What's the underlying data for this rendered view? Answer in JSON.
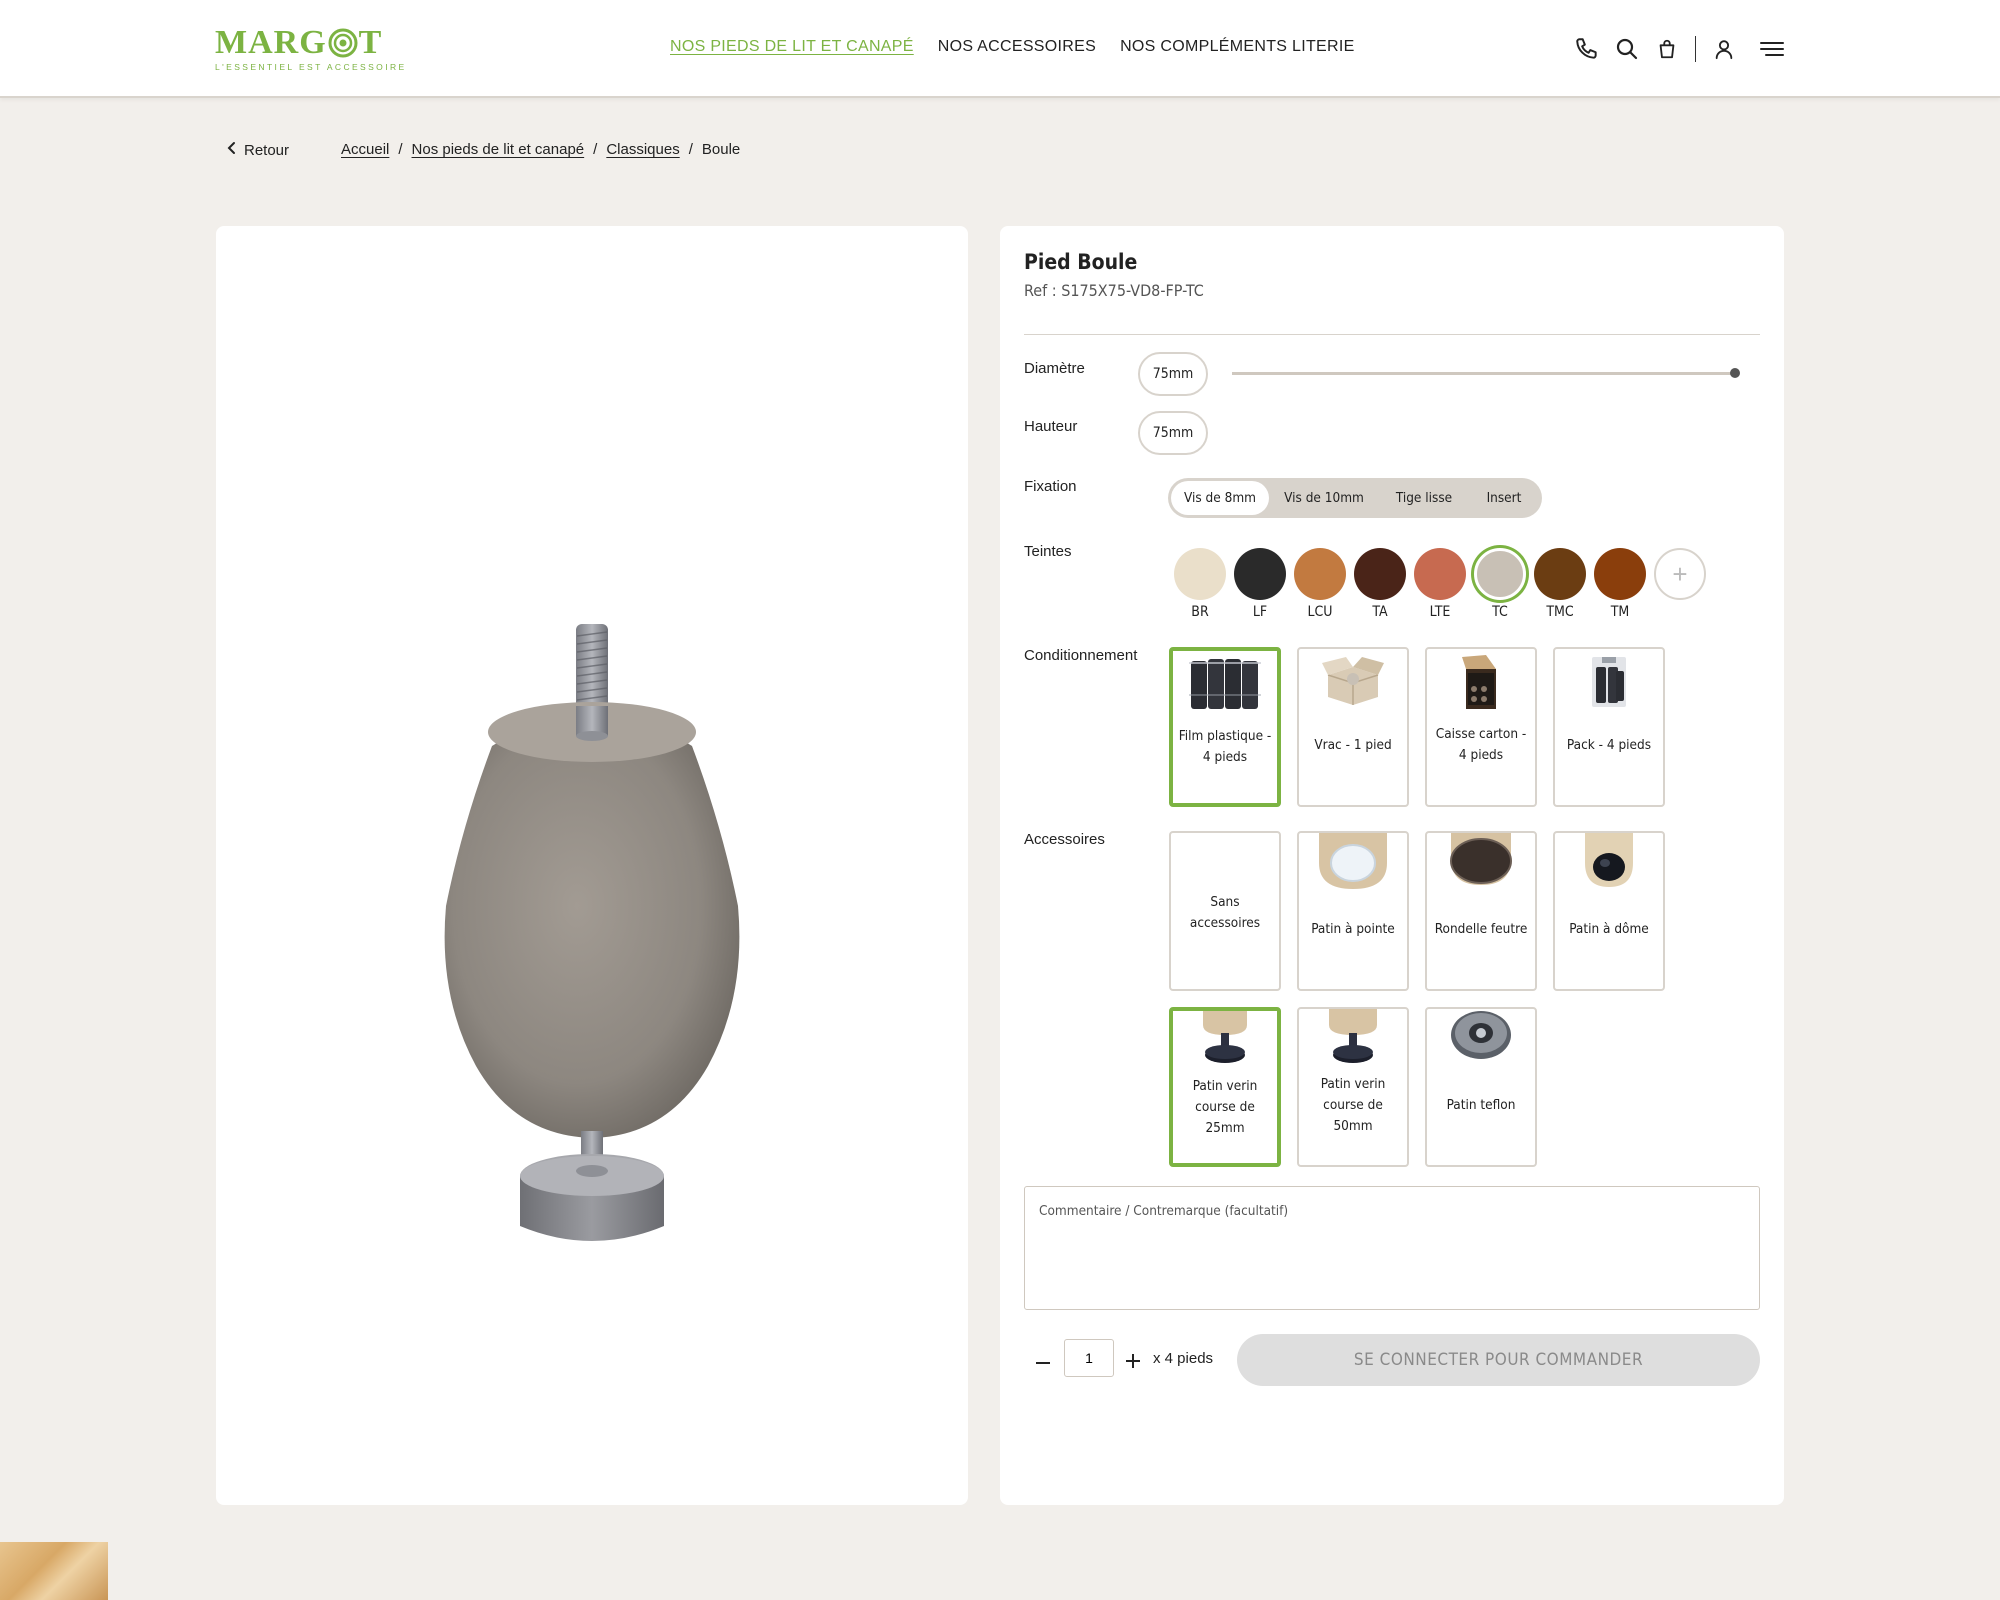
{
  "header": {
    "logo_text": "MARGOT",
    "logo_tagline": "L'ESSENTIEL EST ACCESSOIRE",
    "nav": [
      {
        "label": "NOS PIEDS DE LIT ET CANAPÉ",
        "active": true
      },
      {
        "label": "NOS ACCESSOIRES",
        "active": false
      },
      {
        "label": "NOS COMPLÉMENTS LITERIE",
        "active": false
      }
    ],
    "icons": [
      "phone-icon",
      "search-icon",
      "bag-icon",
      "user-icon",
      "menu-icon"
    ]
  },
  "breadcrumb": {
    "back_label": "Retour",
    "items": [
      "Accueil",
      "Nos pieds de lit et canapé",
      "Classiques"
    ],
    "current": "Boule"
  },
  "product": {
    "title": "Pied Boule",
    "ref": "Ref : S175X75-VD8-FP-TC",
    "image_icon": "ball-foot-product-image"
  },
  "options": {
    "diametre": {
      "label": "Diamètre",
      "value": "75mm"
    },
    "hauteur": {
      "label": "Hauteur",
      "value": "75mm"
    },
    "fixation": {
      "label": "Fixation",
      "options": [
        "Vis de 8mm",
        "Vis de 10mm",
        "Tige lisse",
        "Insert"
      ],
      "selected": "Vis de 8mm"
    },
    "teintes": {
      "label": "Teintes",
      "selected": "TC",
      "swatches": [
        {
          "code": "BR",
          "color": "#eadfca"
        },
        {
          "code": "LF",
          "color": "#2a2a2a"
        },
        {
          "code": "LCU",
          "color": "#c27a40"
        },
        {
          "code": "TA",
          "color": "#4a2418"
        },
        {
          "code": "LTE",
          "color": "#c76a50"
        },
        {
          "code": "TC",
          "color": "#c8c0b5"
        },
        {
          "code": "TMC",
          "color": "#6b3d12"
        },
        {
          "code": "TM",
          "color": "#8a3e0c"
        }
      ]
    },
    "conditionnement": {
      "label": "Conditionnement",
      "items": [
        {
          "label": "Film plastique - 4 pieds",
          "icon": "plastic-film-pack-icon",
          "selected": true
        },
        {
          "label": "Vrac - 1 pied",
          "icon": "open-box-icon",
          "selected": false
        },
        {
          "label": "Caisse carton - 4 pieds",
          "icon": "carton-box-icon",
          "selected": false
        },
        {
          "label": "Pack - 4 pieds",
          "icon": "pack-icon",
          "selected": false
        }
      ]
    },
    "accessoires": {
      "label": "Accessoires",
      "items": [
        {
          "label": "Sans accessoires",
          "icon": "",
          "selected": false
        },
        {
          "label": "Patin à pointe",
          "icon": "pointed-glide-icon",
          "selected": false
        },
        {
          "label": "Rondelle feutre",
          "icon": "felt-washer-icon",
          "selected": false
        },
        {
          "label": "Patin à dôme",
          "icon": "dome-glide-icon",
          "selected": false
        },
        {
          "label": "Patin verin course de 25mm",
          "icon": "leveler-25-icon",
          "selected": true
        },
        {
          "label": "Patin verin course de 50mm",
          "icon": "leveler-50-icon",
          "selected": false
        },
        {
          "label": "Patin teflon",
          "icon": "teflon-glide-icon",
          "selected": false
        }
      ]
    }
  },
  "comment": {
    "placeholder": "Commentaire / Contremarque (facultatif)"
  },
  "order": {
    "quantity": "1",
    "unit_label": "x 4 pieds",
    "button_label": "SE CONNECTER POUR COMMANDER"
  }
}
